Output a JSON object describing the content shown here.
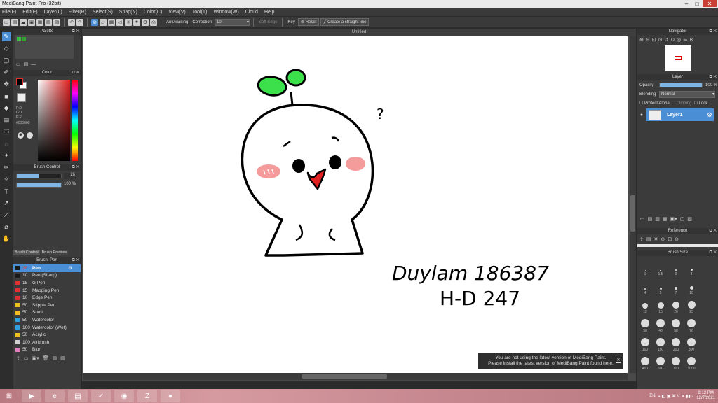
{
  "window": {
    "title": "MediBang Paint Pro (32bit)"
  },
  "menu": [
    "File(F)",
    "Edit(E)",
    "Layer(L)",
    "Filter(R)",
    "Select(S)",
    "Snap(N)",
    "Color(C)",
    "View(V)",
    "Tool(T)",
    "Window(W)",
    "Cloud",
    "Help"
  ],
  "toolbar": {
    "antialiasing": "AntiAliasing",
    "correction_label": "Correction",
    "correction_value": "10",
    "soft_edge": "Soft Edge",
    "key": "Key",
    "reset": "Reset",
    "straight_line": "Create a straight line"
  },
  "document": {
    "tab": "Untitled"
  },
  "palette": {
    "title": "Palette",
    "colors": [
      "#3fbf3f",
      "#2fa52f"
    ]
  },
  "color": {
    "title": "Color",
    "r": "R:0",
    "g": "G:0",
    "b": "B:0",
    "hex": "#000000"
  },
  "brush_control": {
    "title": "Brush Control",
    "size": "26",
    "opacity": "100 %",
    "tab1": "Brush Control",
    "tab2": "Brush Preview"
  },
  "brush_list": {
    "title": "Brush: Pen",
    "items": [
      {
        "size": "26",
        "name": "Pen",
        "color": "#1a1a1a"
      },
      {
        "size": "10",
        "name": "Pen (Sharp)",
        "color": "#1a1a1a"
      },
      {
        "size": "15",
        "name": "G Pen",
        "color": "#e03030"
      },
      {
        "size": "15",
        "name": "Mapping Pen",
        "color": "#e03030"
      },
      {
        "size": "10",
        "name": "Edge Pen",
        "color": "#e03030"
      },
      {
        "size": "50",
        "name": "Stipple Pen",
        "color": "#f0c020"
      },
      {
        "size": "50",
        "name": "Sumi",
        "color": "#f0c020"
      },
      {
        "size": "50",
        "name": "Watercolor",
        "color": "#30a0e0"
      },
      {
        "size": "100",
        "name": "Watercolor (Wet)",
        "color": "#30a0e0"
      },
      {
        "size": "50",
        "name": "Acrylic",
        "color": "#f0c020"
      },
      {
        "size": "100",
        "name": "Airbrush",
        "color": "#d0d0d0"
      },
      {
        "size": "50",
        "name": "Blur",
        "color": "#e080c0"
      }
    ]
  },
  "navigator": {
    "title": "Navigator"
  },
  "layer": {
    "title": "Layer",
    "opacity_label": "Opacity",
    "opacity_value": "100 %",
    "blending_label": "Blending",
    "blending_value": "Normal",
    "protect_alpha": "Protect Alpha",
    "clipping": "Clipping",
    "lock": "Lock",
    "layer_name": "Layer1"
  },
  "reference": {
    "title": "Reference"
  },
  "brush_size": {
    "title": "Brush Size",
    "sizes": [
      "1",
      "1.5",
      "2",
      "3",
      "4",
      "5",
      "7",
      "10",
      "12",
      "15",
      "20",
      "25",
      "30",
      "40",
      "50",
      "70",
      "100",
      "150",
      "200",
      "300",
      "400",
      "500",
      "700",
      "1000"
    ]
  },
  "drawing": {
    "line1": "Duylam 186387",
    "line2": "H-D 247",
    "question": "?"
  },
  "notice": {
    "line1": "You are not using the latest version of MediBang Paint.",
    "line2": "Please install the latest version of MediBang Paint found here."
  },
  "taskbar": {
    "lang": "EN",
    "time": "9:13 PM",
    "date": "12/7/2021"
  }
}
